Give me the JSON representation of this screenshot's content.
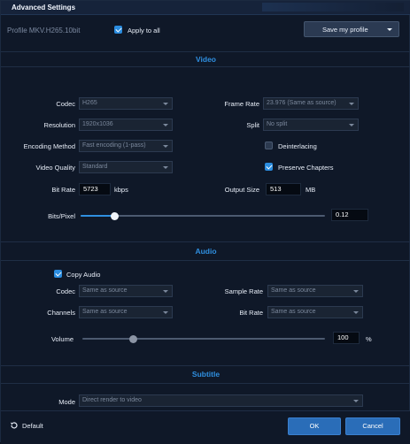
{
  "window": {
    "title": "Advanced Settings"
  },
  "profile": {
    "label": "Profile  MKV.H265.10bit",
    "apply_to_all_label": "Apply to all",
    "apply_to_all_checked": true,
    "save_button": "Save my profile"
  },
  "video": {
    "section_title": "Video",
    "codec_label": "Codec",
    "codec_value": "H265",
    "resolution_label": "Resolution",
    "resolution_value": "1920x1036",
    "encoding_method_label": "Encoding Method",
    "encoding_method_value": "Fast encoding (1-pass)",
    "video_quality_label": "Video Quality",
    "video_quality_value": "Standard",
    "bit_rate_label": "Bit Rate",
    "bit_rate_value": "5723",
    "bit_rate_unit": "kbps",
    "frame_rate_label": "Frame Rate",
    "frame_rate_value": "23.976 (Same as source)",
    "split_label": "Split",
    "split_value": "No split",
    "deinterlacing_label": "Deinterlacing",
    "deinterlacing_checked": false,
    "preserve_chapters_label": "Preserve Chapters",
    "preserve_chapters_checked": true,
    "output_size_label": "Output Size",
    "output_size_value": "513",
    "output_size_unit": "MB",
    "bits_per_pixel_label": "Bits/Pixel",
    "bits_per_pixel_value": "0.12",
    "bits_per_pixel_slider_fraction": 0.14
  },
  "audio": {
    "section_title": "Audio",
    "copy_audio_label": "Copy Audio",
    "copy_audio_checked": true,
    "codec_label": "Codec",
    "codec_value": "Same as source",
    "channels_label": "Channels",
    "channels_value": "Same as source",
    "sample_rate_label": "Sample Rate",
    "sample_rate_value": "Same as source",
    "bit_rate_label": "Bit Rate",
    "bit_rate_value": "Same as source",
    "volume_label": "Volume",
    "volume_value": "100",
    "volume_unit": "%",
    "volume_slider_fraction": 0.21
  },
  "subtitle": {
    "section_title": "Subtitle",
    "mode_label": "Mode",
    "mode_value": "Direct render to video"
  },
  "footer": {
    "default_label": "Default",
    "ok_label": "OK",
    "cancel_label": "Cancel"
  }
}
